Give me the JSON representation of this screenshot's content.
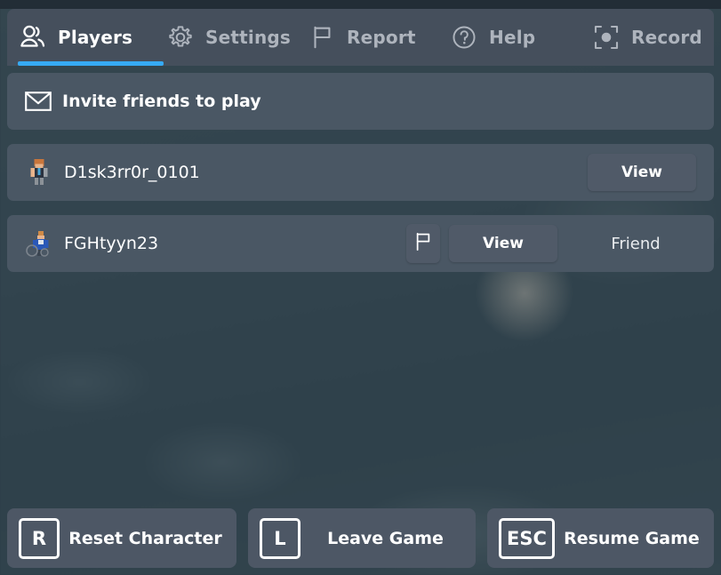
{
  "colors": {
    "accent": "#36aaf4",
    "panel": "#454f5c",
    "row": "#4a5764",
    "button": "#505a68",
    "action": "#4d5765",
    "text_active": "#ffffff",
    "text_inactive": "#aeb4bd",
    "backdrop": "#33454e"
  },
  "tabs": [
    {
      "id": "players",
      "label": "Players",
      "icon": "people-icon",
      "active": true
    },
    {
      "id": "settings",
      "label": "Settings",
      "icon": "gear-icon",
      "active": false
    },
    {
      "id": "report",
      "label": "Report",
      "icon": "flag-icon",
      "active": false
    },
    {
      "id": "help",
      "label": "Help",
      "icon": "question-icon",
      "active": false
    },
    {
      "id": "record",
      "label": "Record",
      "icon": "record-icon",
      "active": false
    }
  ],
  "invite": {
    "label": "Invite friends to play",
    "icon": "envelope-icon"
  },
  "players": [
    {
      "name": "D1sk3rr0r_0101",
      "avatar": "avatar-thumbnail",
      "view_label": "View",
      "has_flag": false,
      "relationship": ""
    },
    {
      "name": "FGHtyyn23",
      "avatar": "avatar-thumbnail",
      "view_label": "View",
      "has_flag": true,
      "flag_icon": "flag-icon",
      "relationship": "Friend"
    }
  ],
  "actions": [
    {
      "id": "reset",
      "key": "R",
      "label": "Reset Character"
    },
    {
      "id": "leave",
      "key": "L",
      "label": "Leave Game"
    },
    {
      "id": "resume",
      "key": "ESC",
      "label": "Resume Game"
    }
  ]
}
